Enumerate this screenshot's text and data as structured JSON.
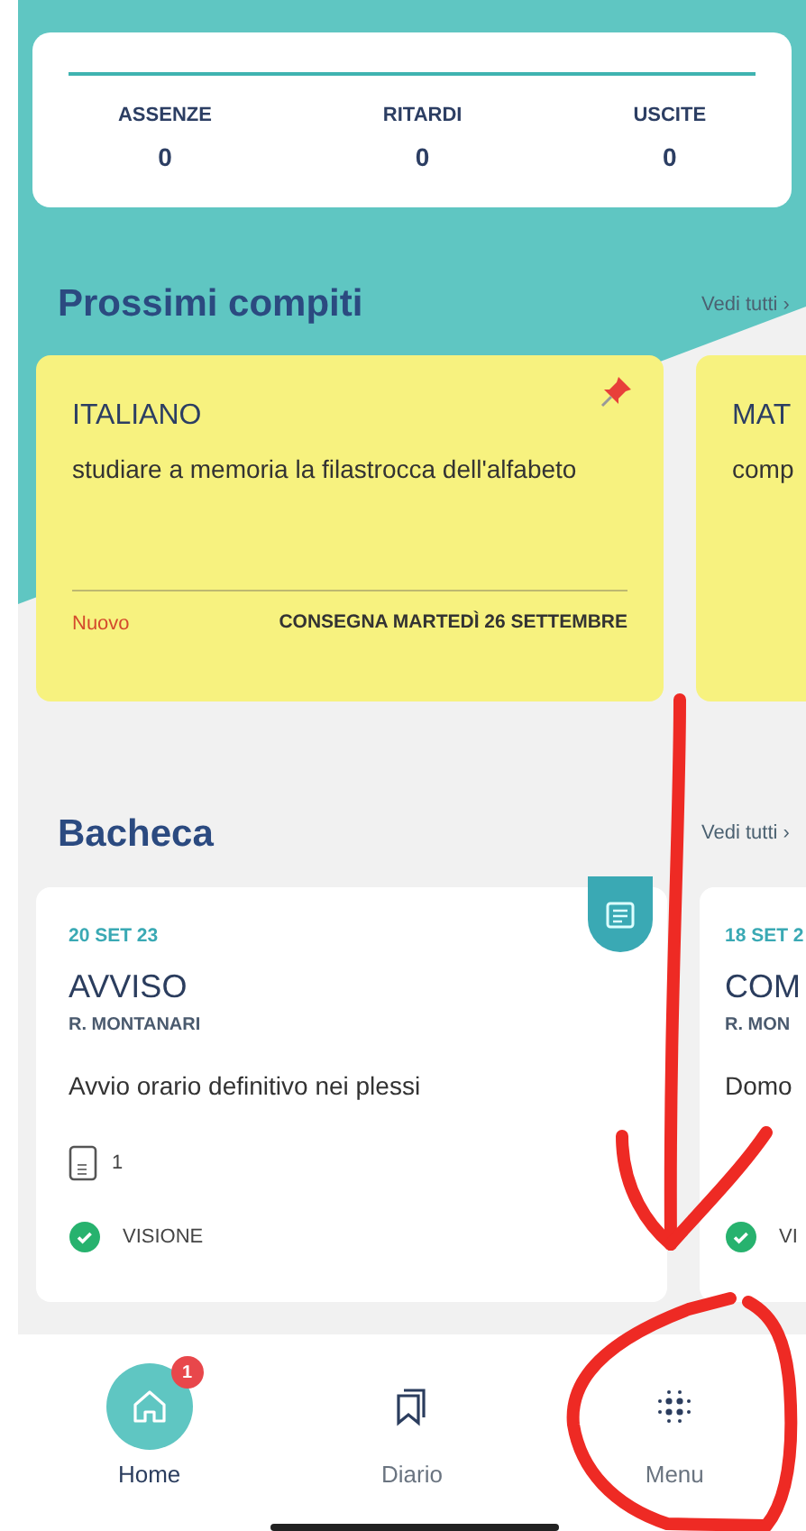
{
  "summary": {
    "stats": [
      {
        "label": "ASSENZE",
        "value": "0"
      },
      {
        "label": "RITARDI",
        "value": "0"
      },
      {
        "label": "USCITE",
        "value": "0"
      }
    ]
  },
  "homework": {
    "title": "Prossimi compiti",
    "see_all": "Vedi tutti ›",
    "cards": [
      {
        "subject": "ITALIANO",
        "text": "studiare a memoria la filastrocca dell'alfabeto",
        "pinned": true,
        "status": "Nuovo",
        "due": "CONSEGNA MARTEDÌ 26 SETTEMBRE"
      },
      {
        "subject": "MAT",
        "text": "comp",
        "pinned": false
      }
    ]
  },
  "board": {
    "title": "Bacheca",
    "see_all": "Vedi tutti ›",
    "cards": [
      {
        "date": "20 SET 23",
        "title": "AVVISO",
        "author": "R. MONTANARI",
        "text": "Avvio orario definitivo nei plessi",
        "attachments": "1",
        "seen": true,
        "seen_label": "VISIONE"
      },
      {
        "date": "18 SET 2",
        "title": "COM",
        "author": "R. MON",
        "text": "Domo",
        "seen": true,
        "seen_label": "VI"
      }
    ]
  },
  "nav": [
    {
      "label": "Home",
      "selected": true,
      "badge": "1"
    },
    {
      "label": "Diario",
      "selected": false
    },
    {
      "label": "Menu",
      "selected": false
    }
  ]
}
